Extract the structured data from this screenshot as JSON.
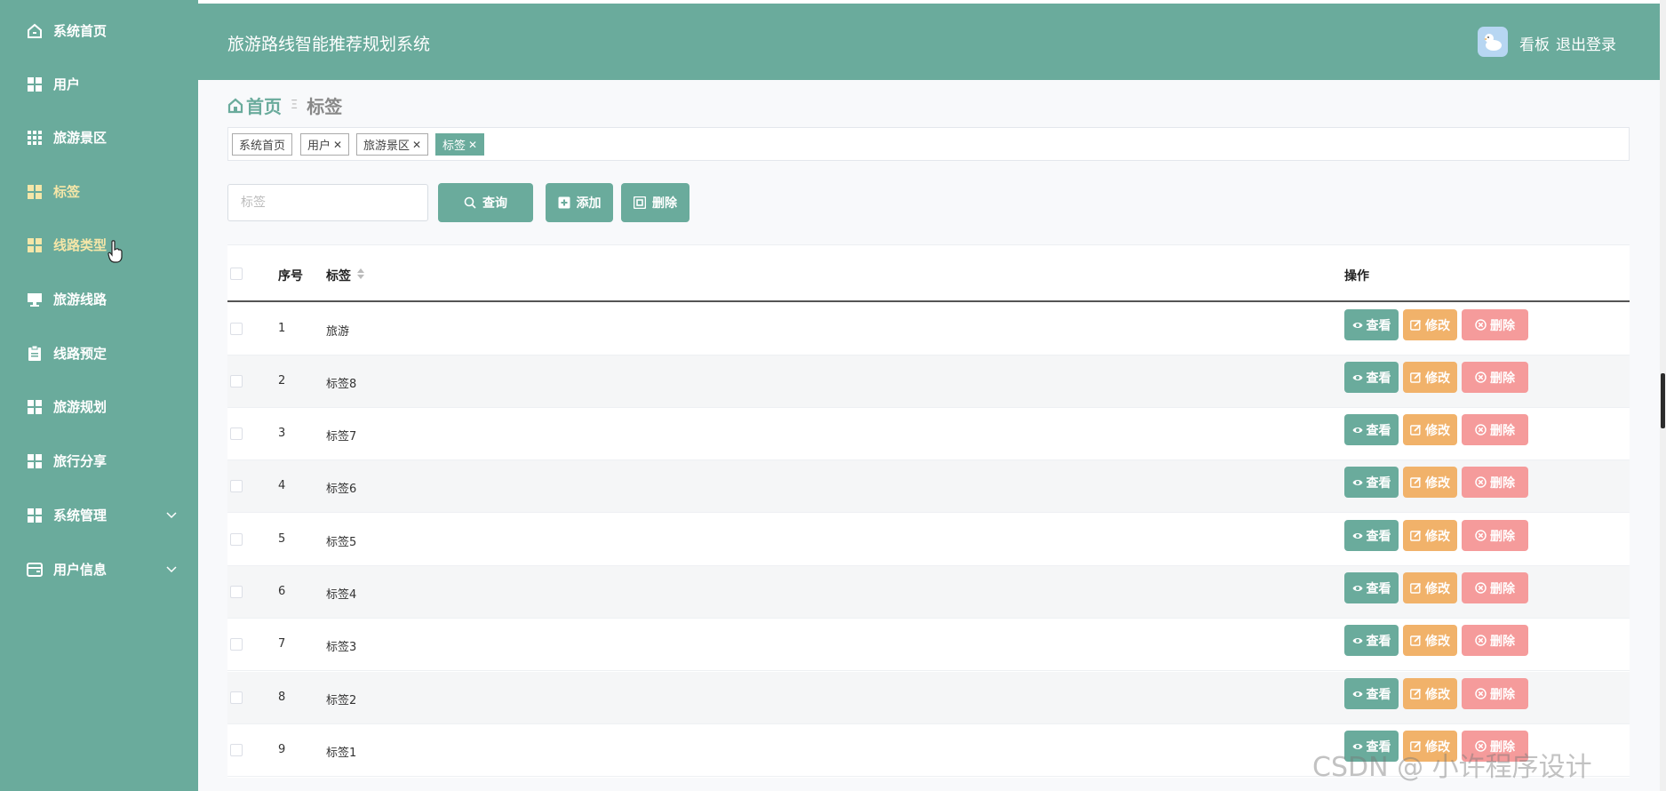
{
  "sidebar": {
    "items": [
      {
        "label": "系统首页"
      },
      {
        "label": "用户"
      },
      {
        "label": "旅游景区"
      },
      {
        "label": "标签"
      },
      {
        "label": "线路类型"
      },
      {
        "label": "旅游线路"
      },
      {
        "label": "线路预定"
      },
      {
        "label": "旅游规划"
      },
      {
        "label": "旅行分享"
      },
      {
        "label": "系统管理"
      },
      {
        "label": "用户信息"
      }
    ]
  },
  "header": {
    "title": "旅游路线智能推荐规划系统",
    "board_label": "看板",
    "logout_label": "退出登录"
  },
  "breadcrumb": {
    "home": "首页",
    "separator": "Ξ",
    "current": "标签"
  },
  "tabs": [
    {
      "label": "系统首页"
    },
    {
      "label": "用户"
    },
    {
      "label": "旅游景区"
    },
    {
      "label": "标签"
    }
  ],
  "search": {
    "placeholder": "标签",
    "query_label": "查询",
    "add_label": "添加",
    "delete_label": "删除"
  },
  "table": {
    "headers": {
      "no": "序号",
      "tag": "标签",
      "action": "操作"
    },
    "rows": [
      {
        "no": "1",
        "tag": "旅游"
      },
      {
        "no": "2",
        "tag": "标签8"
      },
      {
        "no": "3",
        "tag": "标签7"
      },
      {
        "no": "4",
        "tag": "标签6"
      },
      {
        "no": "5",
        "tag": "标签5"
      },
      {
        "no": "6",
        "tag": "标签4"
      },
      {
        "no": "7",
        "tag": "标签3"
      },
      {
        "no": "8",
        "tag": "标签2"
      },
      {
        "no": "9",
        "tag": "标签1"
      }
    ],
    "actions": {
      "view": "查看",
      "edit": "修改",
      "delete": "删除"
    }
  },
  "watermark": "CSDN @ 小许程序设计",
  "colors": {
    "primary": "#6aab9c",
    "edit": "#f1b26a",
    "delete": "#f59b9b",
    "active_menu": "#f5e6a8"
  }
}
